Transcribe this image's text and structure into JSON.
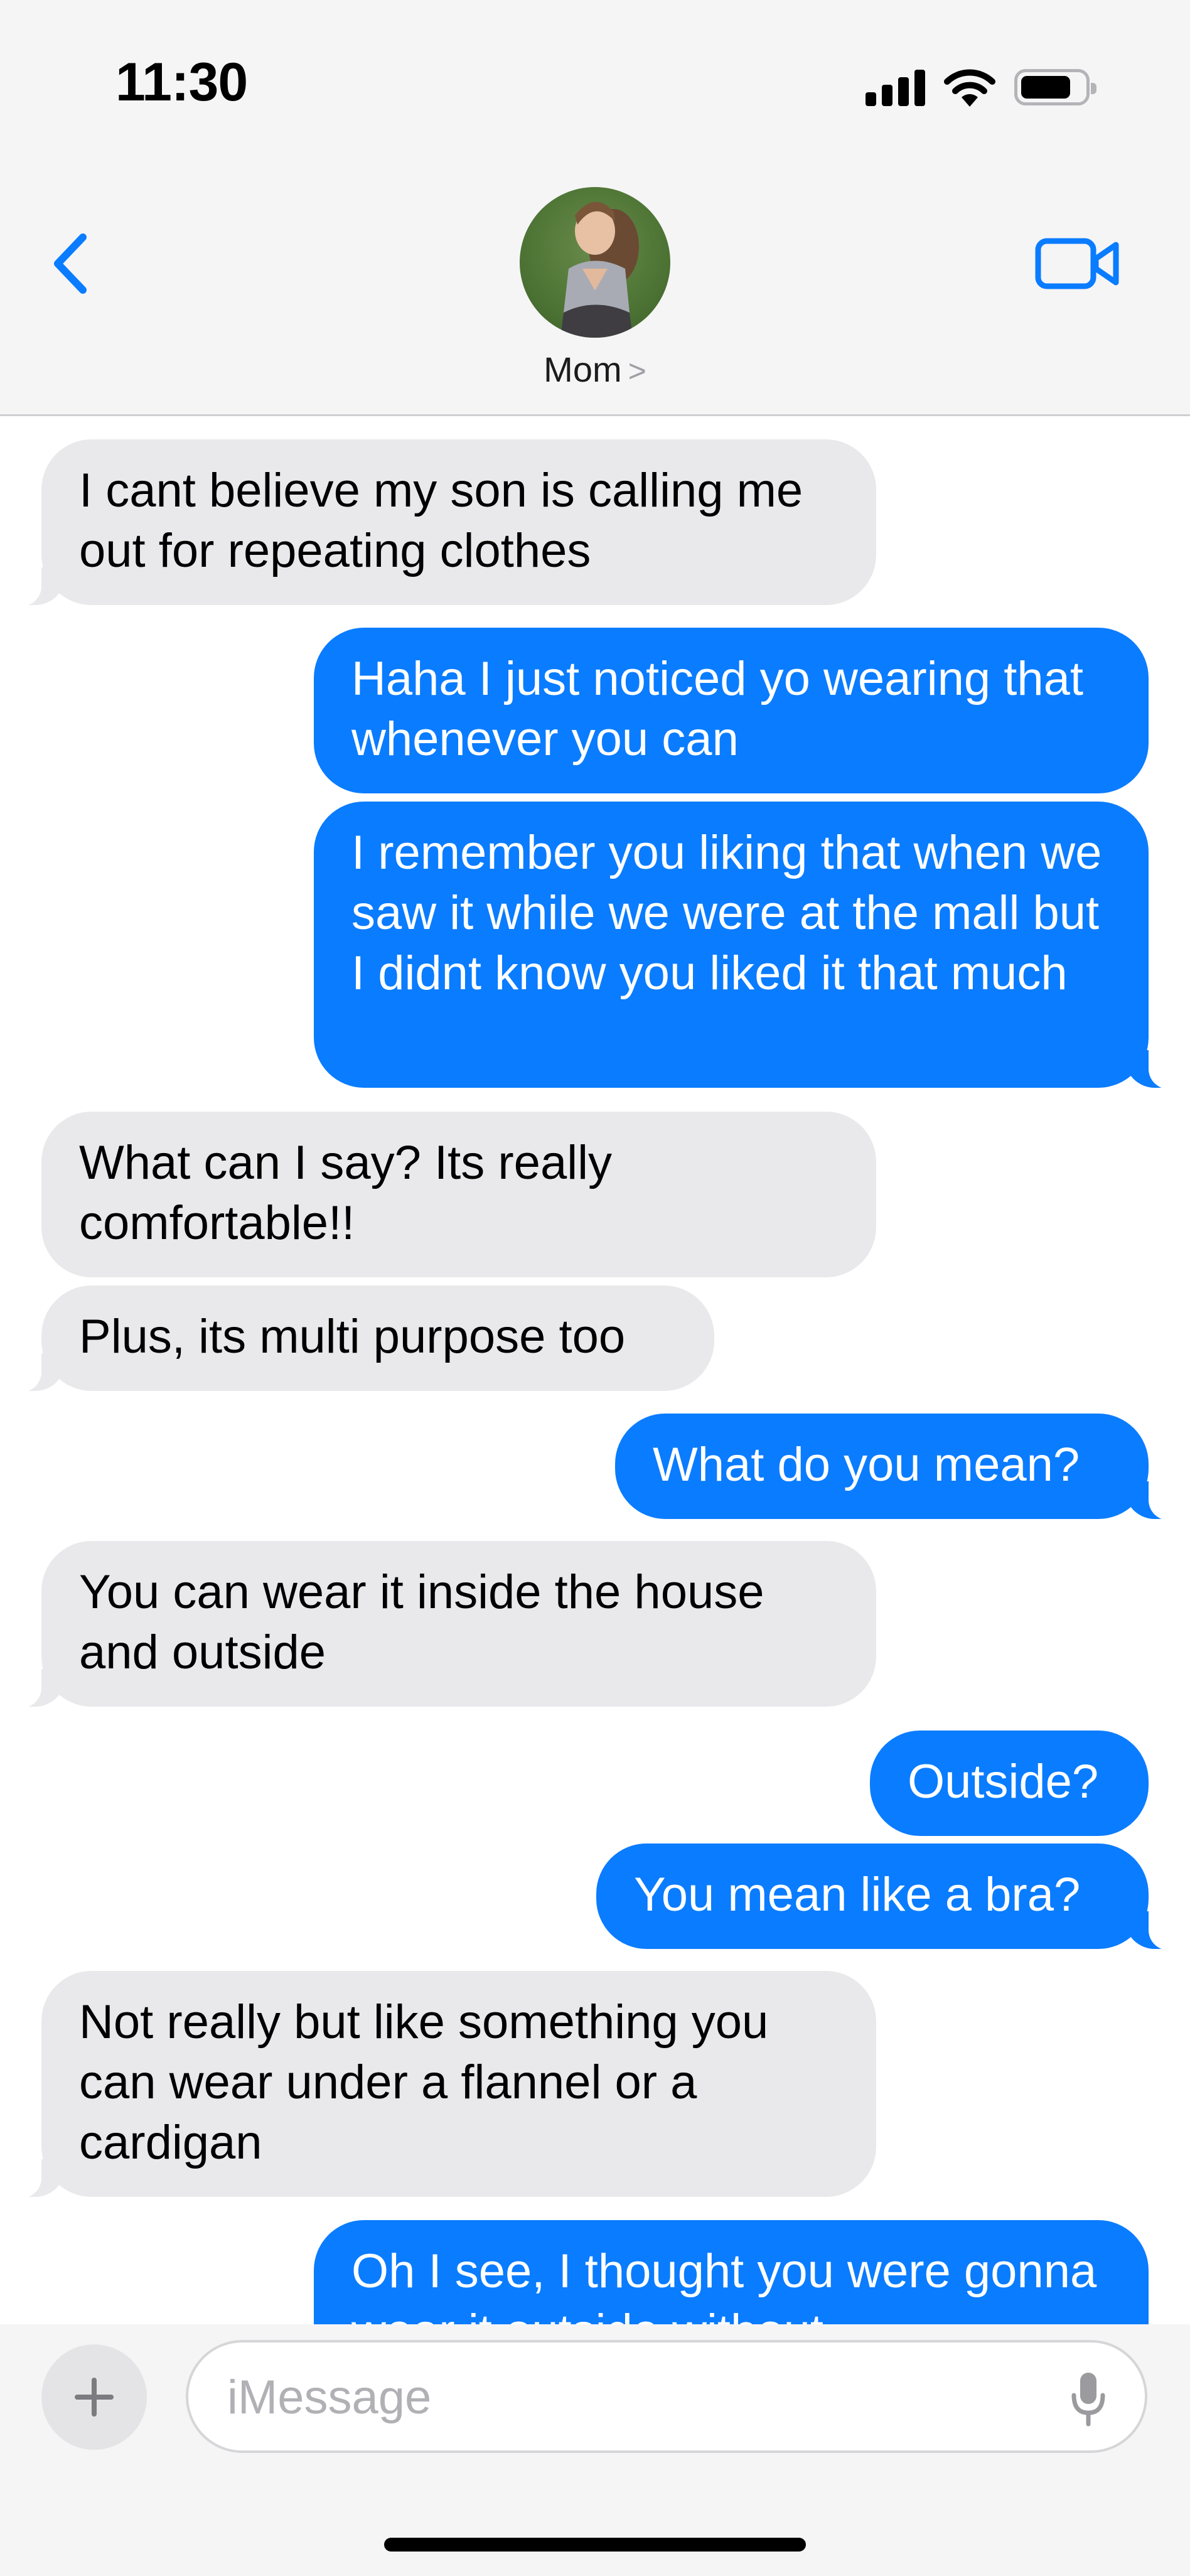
{
  "status_bar": {
    "time": "11:30"
  },
  "header": {
    "contact_name": "Mom",
    "contact_chevron": ">"
  },
  "messages": [
    {
      "from": "contact",
      "text": "I cant believe my son is calling me out for repeating clothes"
    },
    {
      "from": "me",
      "text": "Haha I just noticed yo wearing that whenever you can"
    },
    {
      "from": "me",
      "text": "I remember you liking that when we saw it while we were at the mall but I didnt know you liked it that much"
    },
    {
      "from": "contact",
      "text": "What can I say? Its really comfortable!!"
    },
    {
      "from": "contact",
      "text": "Plus, its multi purpose too"
    },
    {
      "from": "me",
      "text": "What do you mean?"
    },
    {
      "from": "contact",
      "text": "You can wear it inside the house and outside"
    },
    {
      "from": "me",
      "text": "Outside?"
    },
    {
      "from": "me",
      "text": "You mean like a bra?"
    },
    {
      "from": "contact",
      "text": "Not really but like something you can wear under a flannel or a cardigan"
    },
    {
      "from": "me",
      "text": "Oh I see, I thought you were gonna wear it outside without"
    }
  ],
  "composer": {
    "placeholder": "iMessage",
    "value": ""
  },
  "colors": {
    "outgoing": "#0a7cff",
    "incoming": "#e9e9eb",
    "accent": "#0a7cff"
  },
  "icons": {
    "back": "chevron-left-icon",
    "video": "video-camera-icon",
    "plus": "plus-icon",
    "mic": "microphone-icon"
  }
}
